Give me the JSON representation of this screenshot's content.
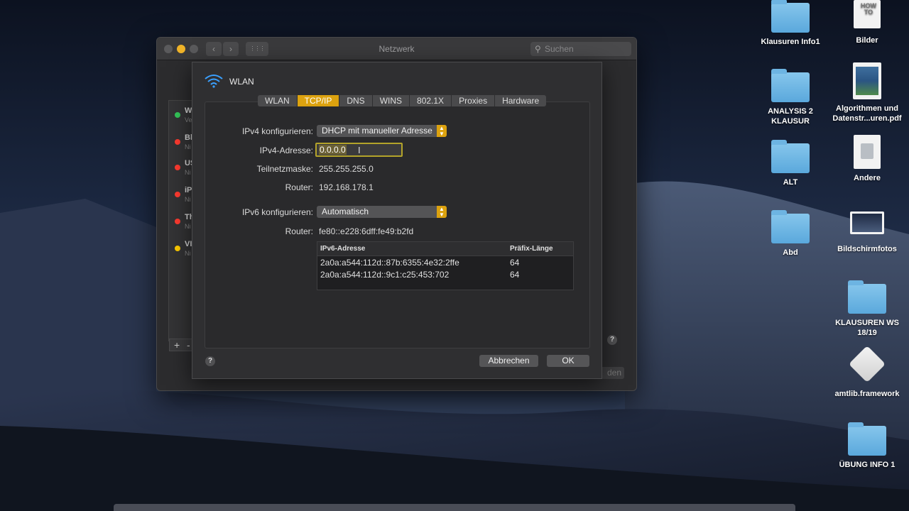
{
  "window": {
    "title": "Netzwerk",
    "search_placeholder": "Suchen",
    "nav_back": "‹",
    "nav_forward": "›",
    "grid_glyph": "⋮⋮⋮"
  },
  "background_list": {
    "items": [
      {
        "title": "W",
        "sub": "Ve",
        "status_color": "#34c759"
      },
      {
        "title": "Bl",
        "sub": "Ni",
        "status_color": "#ff3b30"
      },
      {
        "title": "US",
        "sub": "Ni",
        "status_color": "#ff3b30"
      },
      {
        "title": "iP",
        "sub": "Ni",
        "status_color": "#ff3b30"
      },
      {
        "title": "Th",
        "sub": "Ni",
        "status_color": "#ff3b30"
      },
      {
        "title": "VI",
        "sub": "Ni",
        "status_color": "#ffcc00"
      }
    ],
    "plus": "+",
    "minus": "-",
    "partial_button": "den"
  },
  "sheet": {
    "interface_name": "WLAN",
    "tabs": [
      {
        "label": "WLAN",
        "active": false
      },
      {
        "label": "TCP/IP",
        "active": true
      },
      {
        "label": "DNS",
        "active": false
      },
      {
        "label": "WINS",
        "active": false
      },
      {
        "label": "802.1X",
        "active": false
      },
      {
        "label": "Proxies",
        "active": false
      },
      {
        "label": "Hardware",
        "active": false
      }
    ],
    "ipv4_config_label": "IPv4 konfigurieren:",
    "ipv4_config_value": "DHCP mit manueller Adresse",
    "ipv4_address_label": "IPv4-Adresse:",
    "ipv4_address_value": "0.0.0.0",
    "subnet_label": "Teilnetzmaske:",
    "subnet_value": "255.255.255.0",
    "router_label": "Router:",
    "router_value": "192.168.178.1",
    "ipv6_config_label": "IPv6 konfigurieren:",
    "ipv6_config_value": "Automatisch",
    "ipv6_router_label": "Router:",
    "ipv6_router_value": "fe80::e228:6dff:fe49:b2fd",
    "ipv6_table": {
      "headers": [
        "IPv6-Adresse",
        "Präfix-Länge"
      ],
      "rows": [
        [
          "2a0a:a544:112d::87b:6355:4e32:2ffe",
          "64"
        ],
        [
          "2a0a:a544:112d::9c1:c25:453:702",
          "64"
        ]
      ]
    },
    "help": "?",
    "cancel_label": "Abbrechen",
    "ok_label": "OK"
  },
  "desktop_icons": [
    {
      "label": "Klausuren Info1",
      "kind": "folder"
    },
    {
      "label": "Bilder",
      "kind": "document",
      "thumb_text": "HOW TO"
    },
    {
      "label": "ANALYSIS 2 KLAUSUR",
      "kind": "folder"
    },
    {
      "label": "Algorithmen und Datenstr...uren.pdf",
      "kind": "pdf"
    },
    {
      "label": "ALT",
      "kind": "folder"
    },
    {
      "label": "Andere",
      "kind": "document"
    },
    {
      "label": "Abd",
      "kind": "folder"
    },
    {
      "label": "Bildschirmfotos",
      "kind": "image"
    },
    {
      "label": "KLAUSUREN WS 18/19",
      "kind": "folder"
    },
    {
      "label": "amtlib.framework",
      "kind": "framework"
    },
    {
      "label": "ÜBUNG INFO 1",
      "kind": "folder"
    }
  ],
  "colors": {
    "accent": "#dca20f",
    "window_bg": "#2c2c2e",
    "sheet_bg": "#2f2f31"
  }
}
